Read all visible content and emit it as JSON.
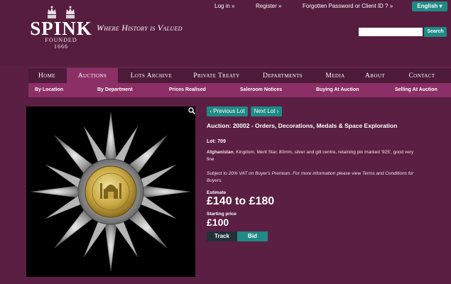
{
  "brand": {
    "name": "SPINK",
    "tagline": "Where History is Valued",
    "founded_label": "FOUNDED",
    "founded_year": "1666"
  },
  "top_links": {
    "login": "Log in »",
    "register": "Register »",
    "forgot": "Forgotten Password or Client ID ? »",
    "language": "English ▾"
  },
  "search": {
    "placeholder": "",
    "button": "Search"
  },
  "main_nav": [
    "Home",
    "Auctions",
    "Lots Archive",
    "Private Treaty",
    "Departments",
    "Media",
    "About",
    "Contact"
  ],
  "main_nav_active": "Auctions",
  "sub_nav": [
    "By Location",
    "By Department",
    "Prices Realised",
    "Saleroom Notices",
    "Buying At Auction",
    "Selling At Auction"
  ],
  "lot": {
    "prev_label": "‹ Previous Lot",
    "next_label": "Next Lot ›",
    "title": "Auction: 20002 - Orders, Decorations, Medals & Space Exploration",
    "lot_number": "Lot: 709",
    "desc_bold": "Afghanistan",
    "desc_rest": ", Kingdom, Merit Star, 80mm, silver and gilt centre, retaining pin marked '925', good very fine",
    "vat_note": "Subject to 20% VAT on Buyer's Premium. For more information please view Terms and Conditions for Buyers.",
    "estimate_label": "Estimate",
    "estimate_value": "£140 to £180",
    "starting_label": "Starting price",
    "starting_value": "£100",
    "track_label": "Track",
    "bid_label": "Bid"
  },
  "icons": [
    "crown-icon",
    "search-icon",
    "zoom-icon"
  ],
  "colors": {
    "background": "#5a1f42",
    "accent": "#1f8a86",
    "nav_active": "#8c2f66"
  }
}
